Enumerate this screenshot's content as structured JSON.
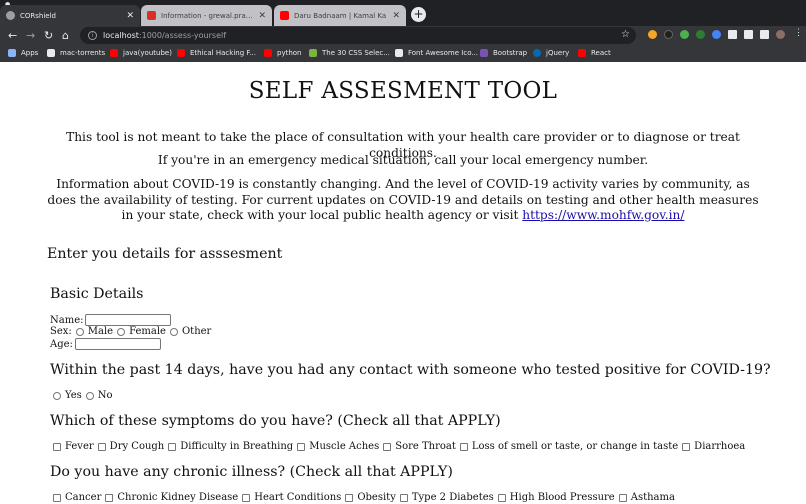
{
  "browser": {
    "tabs": [
      {
        "title": "CORshield",
        "active": true,
        "favicon_color": "#9aa0a6"
      },
      {
        "title": "Information - grewal.prateek10",
        "active": false,
        "favicon_color": "#d93025"
      },
      {
        "title": "Daru Badnaam | Kamal Ka",
        "active": false,
        "favicon_color": "#ff0000"
      }
    ],
    "new_tab_label": "+",
    "address": {
      "host": "localhost",
      "path": ":1000/assess-yourself"
    },
    "bookmarks": [
      {
        "label": "Apps",
        "color": "#8ab4f8"
      },
      {
        "label": "mac-torrents",
        "color": "#e8eaed"
      },
      {
        "label": "java(youtube)",
        "color": "#ff0000"
      },
      {
        "label": "Ethical Hacking F...",
        "color": "#ff0000"
      },
      {
        "label": "python",
        "color": "#ff0000"
      },
      {
        "label": "The 30 CSS Selec...",
        "color": "#7cb342"
      },
      {
        "label": "Font Awesome Ico...",
        "color": "#e8eaed"
      },
      {
        "label": "Bootstrap",
        "color": "#7952b3"
      },
      {
        "label": "jQuery",
        "color": "#0769ad"
      },
      {
        "label": "React",
        "color": "#ff0000"
      }
    ]
  },
  "page": {
    "title": "SELF ASSESMENT TOOL",
    "intro": [
      "This tool is not meant to take the place of consultation with your health care provider or to diagnose or treat conditions.",
      "If you're in an emergency medical situation, call your local emergency number.",
      "Information about COVID-19 is constantly changing. And the level of COVID-19 activity varies by community, as does the availability of testing. For current updates on COVID-19 and details on testing and other health measures in your state, check with your local public health agency or visit "
    ],
    "intro_link": "https://www.mohfw.gov.in/",
    "form_intro": "Enter you details for asssesment",
    "basic": {
      "heading": "Basic Details",
      "name_label": "Name:",
      "sex_label": "Sex:",
      "sex_options": [
        "Male",
        "Female",
        "Other"
      ],
      "age_label": "Age:"
    },
    "contact": {
      "question": "Within the past 14 days, have you had any contact with someone who tested positive for COVID-19?",
      "options": [
        "Yes",
        "No"
      ]
    },
    "symptoms": {
      "question": "Which of these symptoms do you have? (Check all that APPLY)",
      "options": [
        "Fever",
        "Dry Cough",
        "Difficulty in Breathing",
        "Muscle Aches",
        "Sore Throat",
        "Loss of smell or taste, or change in taste",
        "Diarrhoea"
      ]
    },
    "chronic": {
      "question": "Do you have any chronic illness? (Check all that APPLY)",
      "options": [
        "Cancer",
        "Chronic Kidney Disease",
        "Heart Conditions",
        "Obesity",
        "Type 2 Diabetes",
        "High Blood Pressure",
        "Asthama"
      ]
    }
  }
}
